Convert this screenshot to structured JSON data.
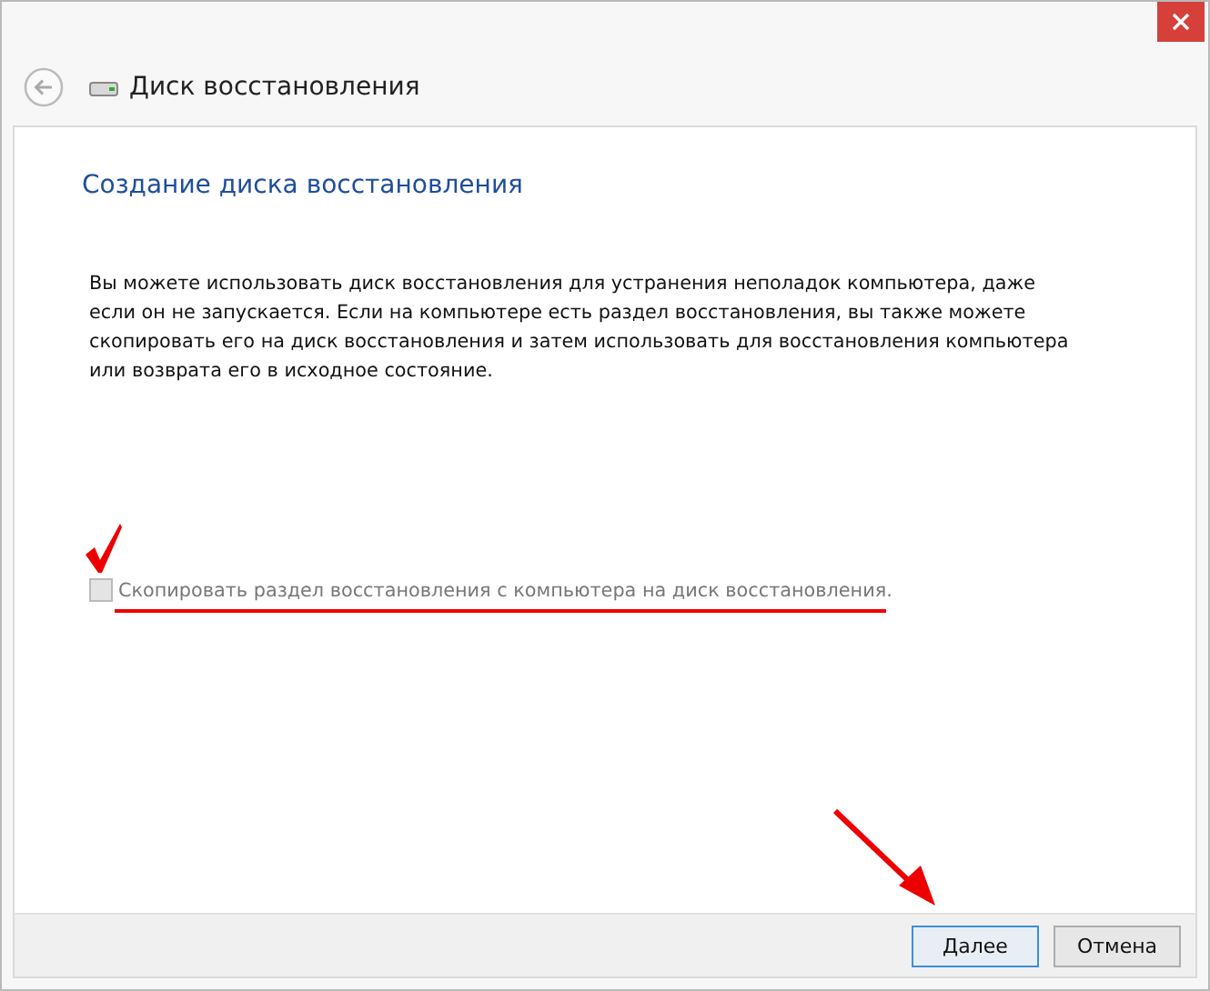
{
  "window": {
    "title": "Диск восстановления"
  },
  "heading": "Создание диска восстановления",
  "description": "Вы можете использовать диск восстановления для устранения неполадок компьютера, даже если он не запускается. Если на компьютере есть раздел восстановления, вы также можете скопировать его на диск восстановления и затем использовать для восстановления компьютера или возврата его в исходное состояние.",
  "option": {
    "label": "Скопировать раздел восстановления с компьютера на диск восстановления.",
    "checked": false,
    "disabled": true
  },
  "buttons": [
    {
      "label": "Далее",
      "default": true
    },
    {
      "label": "Отмена",
      "default": false
    }
  ]
}
